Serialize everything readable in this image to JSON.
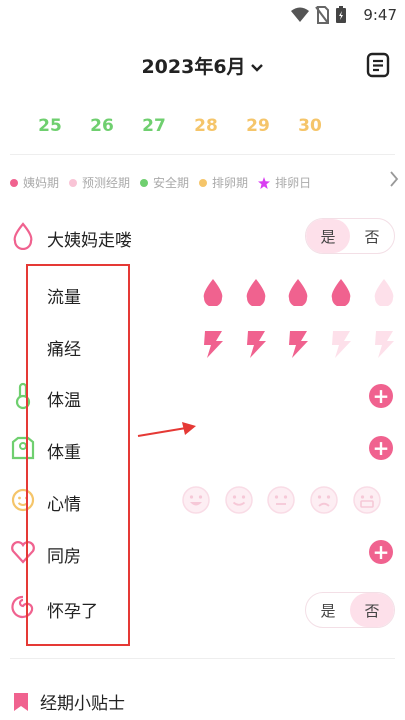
{
  "status_bar": {
    "time": "9:47"
  },
  "header": {
    "title": "2023年6月",
    "chevron": "chevron-down-icon",
    "note_icon": "notebook-icon"
  },
  "dates": [
    {
      "day": "25",
      "color": "#6fcf6f"
    },
    {
      "day": "26",
      "color": "#6fcf6f"
    },
    {
      "day": "27",
      "color": "#6fcf6f"
    },
    {
      "day": "28",
      "color": "#f5c56a"
    },
    {
      "day": "29",
      "color": "#f5c56a"
    },
    {
      "day": "30",
      "color": "#f5c56a"
    }
  ],
  "legend": [
    {
      "label": "姨妈期",
      "color": "#f0628f"
    },
    {
      "label": "预测经期",
      "color": "#f9c4d6"
    },
    {
      "label": "安全期",
      "color": "#6fcf6f"
    },
    {
      "label": "排卵期",
      "color": "#f5c56a"
    },
    {
      "label": "排卵日",
      "color": "#d93df2"
    }
  ],
  "rows": {
    "period": {
      "label": "大姨妈走喽",
      "yes": "是",
      "no": "否",
      "selected": "是"
    },
    "flow": {
      "label": "流量",
      "level": 4,
      "max": 5
    },
    "cramps": {
      "label": "痛经",
      "level": 3,
      "max": 5
    },
    "temperature": {
      "label": "体温"
    },
    "weight": {
      "label": "体重"
    },
    "mood": {
      "label": "心情",
      "options": [
        "happy",
        "smile",
        "neutral",
        "sad",
        "angry"
      ]
    },
    "intimacy": {
      "label": "同房"
    },
    "pregnant": {
      "label": "怀孕了",
      "yes": "是",
      "no": "否",
      "selected": "否"
    }
  },
  "tips": {
    "label": "经期小贴士"
  },
  "colors": {
    "accent": "#f0628f",
    "accent_light": "#fde0ea",
    "annotation": "#e53935"
  }
}
